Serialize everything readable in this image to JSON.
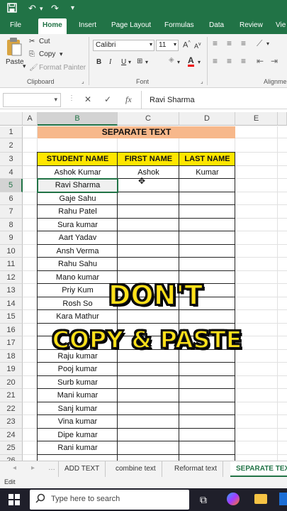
{
  "titlebar": {
    "save_icon": "save-icon",
    "undo_icon": "undo-icon",
    "redo_icon": "redo-icon"
  },
  "ribbon_tabs": [
    "File",
    "Home",
    "Insert",
    "Page Layout",
    "Formulas",
    "Data",
    "Review",
    "View"
  ],
  "ribbon_tabs_display": [
    "File",
    "Home",
    "Insert",
    "Page Layout",
    "Formulas",
    "Data",
    "Review",
    "Vie"
  ],
  "clipboard": {
    "paste": "Paste",
    "cut": "Cut",
    "copy": "Copy",
    "format_painter": "Format Painter",
    "group": "Clipboard"
  },
  "font": {
    "name": "Calibri",
    "size": "11",
    "bold": "B",
    "italic": "I",
    "underline": "U",
    "group": "Font"
  },
  "alignment": {
    "group": "Alignme"
  },
  "formula_bar": {
    "namebox": "",
    "fx": "fx",
    "value": "Ravi Sharma"
  },
  "columns": [
    "A",
    "B",
    "C",
    "D",
    "E"
  ],
  "rows": [
    "1",
    "2",
    "3",
    "4",
    "5",
    "6",
    "7",
    "8",
    "9",
    "10",
    "11",
    "12",
    "13",
    "14",
    "15",
    "16",
    "17",
    "18",
    "19",
    "20",
    "21",
    "22",
    "23",
    "24",
    "25",
    "26"
  ],
  "sheet": {
    "title": "SEPARATE TEXT",
    "headers": [
      "STUDENT  NAME",
      "FIRST NAME",
      "LAST NAME"
    ],
    "row4": [
      "Ashok Kumar",
      "Ashok",
      "Kumar"
    ],
    "names": [
      "Ravi  Sharma",
      "Gaje Sahu",
      "Rahu Patel",
      "Sura kumar",
      "Aart Yadav",
      "Ansh Verma",
      "Rahu Sahu",
      "Mano kumar",
      "Priy Kum",
      "Rosh So",
      "Kara Mathur",
      "",
      "",
      "Raju kumar",
      "Pooj kumar",
      "Surb kumar",
      "Mani kumar",
      "Sanj kumar",
      "Vina kumar",
      "Dipe kumar",
      "Rani kumar",
      ""
    ],
    "row17_fragment": "a"
  },
  "overlay": {
    "line1": "DON'T",
    "line2": "COPY & PASTE"
  },
  "sheet_tabs": [
    "ADD TEXT",
    "combine text",
    "Reformat text",
    "SEPARATE TEX"
  ],
  "status": {
    "mode": "Edit"
  },
  "taskbar": {
    "search_placeholder": "Type here to search"
  },
  "colors": {
    "excel_green": "#217346",
    "title_fill": "#f7b88b",
    "header_fill": "#ffe600",
    "overlay_text": "#ffe11a"
  }
}
